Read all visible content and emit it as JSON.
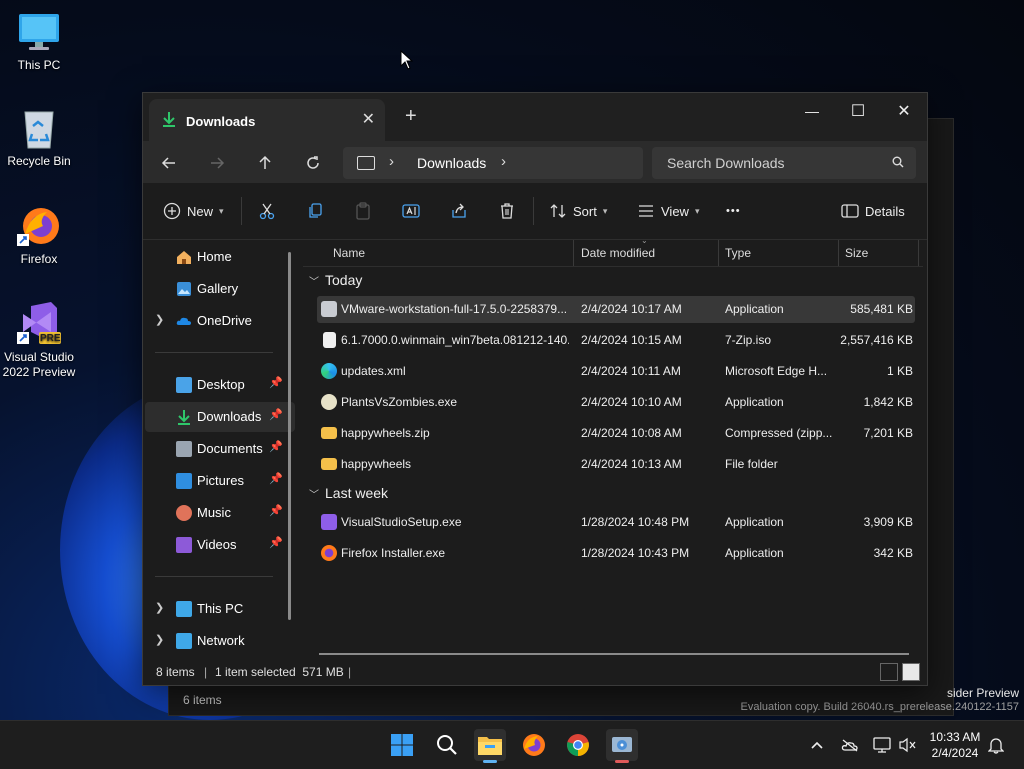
{
  "desktop": {
    "icons": [
      {
        "label": "This PC"
      },
      {
        "label": "Recycle Bin"
      },
      {
        "label": "Firefox"
      },
      {
        "label": "Visual Studio 2022 Preview",
        "badge": "PRE"
      }
    ],
    "watermark_line1": "sider Preview",
    "watermark_line2": "Evaluation copy. Build 26040.rs_prerelease.240122-1157"
  },
  "background_window": {
    "status": "6 items"
  },
  "explorer": {
    "tab_title": "Downloads",
    "tab_close": "✕",
    "new_tab": "+",
    "window_controls": {
      "minimize": "—",
      "maximize": "☐",
      "close": "✕"
    },
    "breadcrumb": [
      "Downloads"
    ],
    "search_placeholder": "Search Downloads",
    "toolbar": {
      "new_label": "New",
      "sort_label": "Sort",
      "view_label": "View",
      "more_label": "•••",
      "details_label": "Details"
    },
    "nav": {
      "home": "Home",
      "gallery": "Gallery",
      "onedrive": "OneDrive",
      "desktop": "Desktop",
      "downloads": "Downloads",
      "documents": "Documents",
      "pictures": "Pictures",
      "music": "Music",
      "videos": "Videos",
      "thispc": "This PC",
      "network": "Network"
    },
    "columns": {
      "name": "Name",
      "date": "Date modified",
      "type": "Type",
      "size": "Size"
    },
    "groups": [
      {
        "label": "Today",
        "files": [
          {
            "name": "VMware-workstation-full-17.5.0-2258379...",
            "date": "2/4/2024 10:17 AM",
            "type": "Application",
            "size": "585,481 KB",
            "icon": "vmware-installer-icon",
            "selected": true
          },
          {
            "name": "6.1.7000.0.winmain_win7beta.081212-140...",
            "date": "2/4/2024 10:15 AM",
            "type": "7-Zip.iso",
            "size": "2,557,416 KB",
            "icon": "document-icon"
          },
          {
            "name": "updates.xml",
            "date": "2/4/2024 10:11 AM",
            "type": "Microsoft Edge H...",
            "size": "1 KB",
            "icon": "edge-icon"
          },
          {
            "name": "PlantsVsZombies.exe",
            "date": "2/4/2024 10:10 AM",
            "type": "Application",
            "size": "1,842 KB",
            "icon": "plants-vs-zombies-icon"
          },
          {
            "name": "happywheels.zip",
            "date": "2/4/2024 10:08 AM",
            "type": "Compressed (zipp...",
            "size": "7,201 KB",
            "icon": "zip-folder-icon"
          },
          {
            "name": "happywheels",
            "date": "2/4/2024 10:13 AM",
            "type": "File folder",
            "size": "",
            "icon": "folder-icon"
          }
        ]
      },
      {
        "label": "Last week",
        "files": [
          {
            "name": "VisualStudioSetup.exe",
            "date": "1/28/2024 10:48 PM",
            "type": "Application",
            "size": "3,909 KB",
            "icon": "visual-studio-icon"
          },
          {
            "name": "Firefox Installer.exe",
            "date": "1/28/2024 10:43 PM",
            "type": "Application",
            "size": "342 KB",
            "icon": "firefox-installer-icon"
          }
        ]
      }
    ],
    "status": {
      "items": "8 items",
      "selection": "1 item selected  571 MB"
    }
  },
  "taskbar": {
    "clock_time": "10:33 AM",
    "clock_date": "2/4/2024"
  },
  "colors": {
    "accent": "#5fb2f2",
    "selected_row": "#383838",
    "window_bg": "#1c1c1c"
  }
}
